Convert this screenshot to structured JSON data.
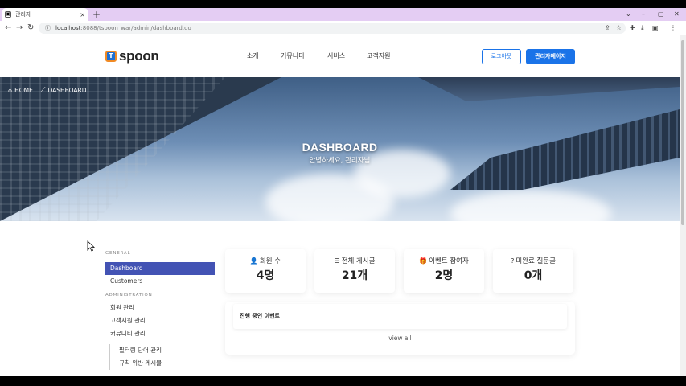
{
  "browser": {
    "tab_title": "관리자",
    "tab_close": "×",
    "new_tab": "+",
    "url_host": "localhost",
    "url_rest": ":8088/tspoon_war/admin/dashboard.do",
    "window_controls": [
      "⌄",
      "–",
      "▢",
      "✕"
    ]
  },
  "header": {
    "logo_text": "spoon",
    "logo_mark": "T",
    "nav": [
      "소개",
      "커뮤니티",
      "서비스",
      "고객지원"
    ],
    "logout_label": "로그아웃",
    "admin_label": "관리자페이지"
  },
  "hero": {
    "breadcrumbs": [
      {
        "icon": "home-icon",
        "label": "HOME"
      },
      {
        "icon": "chart-icon",
        "label": "DASHBOARD"
      }
    ],
    "title": "DASHBOARD",
    "subtitle": "안녕하세요, 관리자님"
  },
  "sidebar": {
    "general_heading": "GENERAL",
    "general_items": [
      "Dashboard",
      "Customers"
    ],
    "admin_heading": "ADMINISTRATION",
    "admin_items": [
      "회원 관리",
      "고객지원 관리",
      "커뮤니티 관리"
    ],
    "community_sub": [
      "필터링 단어 관리",
      "규칙 위반 게시물"
    ]
  },
  "stats": [
    {
      "icon": "user-icon",
      "label": "회원 수",
      "value": "4명"
    },
    {
      "icon": "list-icon",
      "label": "전체 게시글",
      "value": "21개"
    },
    {
      "icon": "gift-icon",
      "label": "이벤트 참여자",
      "value": "2명"
    },
    {
      "icon": "question-icon",
      "label": "미완료 질문글",
      "value": "0개"
    }
  ],
  "events": {
    "title": "진행 중인 이벤트",
    "view_all": "view all"
  },
  "colors": {
    "accent": "#1a73e8",
    "sidebar_active": "#4353b4",
    "tab_strip": "#e4cdf3"
  }
}
